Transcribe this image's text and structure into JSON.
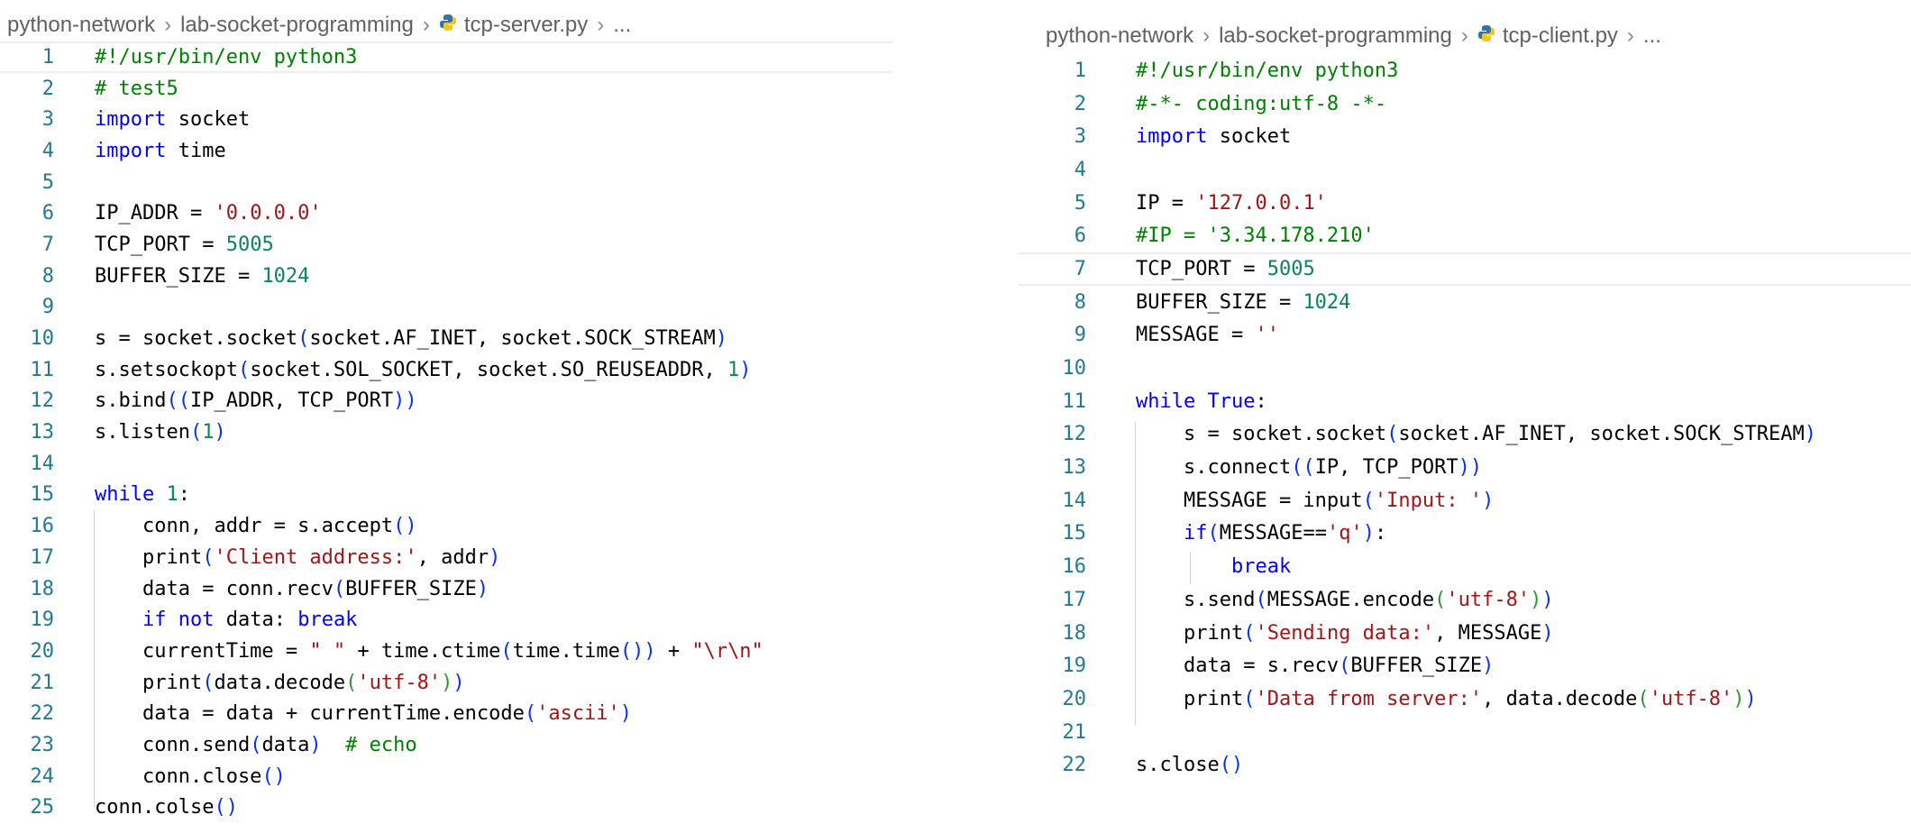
{
  "left_pane": {
    "breadcrumb": {
      "folder": "python-network",
      "subfolder": "lab-socket-programming",
      "file": "tcp-server.py",
      "more": "..."
    },
    "lines": [
      {
        "n": "1",
        "tokens": [
          {
            "t": "#!/usr/bin/env python3",
            "c": "#008000"
          }
        ]
      },
      {
        "n": "2",
        "tokens": [
          {
            "t": "# test5",
            "c": "#008000"
          }
        ]
      },
      {
        "n": "3",
        "tokens": [
          {
            "t": "import",
            "c": "#0000ff"
          },
          {
            "t": " socket",
            "c": "#000000"
          }
        ]
      },
      {
        "n": "4",
        "tokens": [
          {
            "t": "import",
            "c": "#0000ff"
          },
          {
            "t": " time",
            "c": "#000000"
          }
        ]
      },
      {
        "n": "5",
        "tokens": []
      },
      {
        "n": "6",
        "tokens": [
          {
            "t": "IP_ADDR = ",
            "c": "#000000"
          },
          {
            "t": "'0.0.0.0'",
            "c": "#a31515"
          }
        ]
      },
      {
        "n": "7",
        "tokens": [
          {
            "t": "TCP_PORT = ",
            "c": "#000000"
          },
          {
            "t": "5005",
            "c": "#098658"
          }
        ]
      },
      {
        "n": "8",
        "tokens": [
          {
            "t": "BUFFER_SIZE = ",
            "c": "#000000"
          },
          {
            "t": "1024",
            "c": "#098658"
          }
        ]
      },
      {
        "n": "9",
        "tokens": []
      },
      {
        "n": "10",
        "tokens": [
          {
            "t": "s = socket.socket",
            "c": "#000000"
          },
          {
            "t": "(",
            "c": "#0431fa"
          },
          {
            "t": "socket.AF_INET, socket.SOCK_STREAM",
            "c": "#000000"
          },
          {
            "t": ")",
            "c": "#0431fa"
          }
        ]
      },
      {
        "n": "11",
        "tokens": [
          {
            "t": "s.setsockopt",
            "c": "#000000"
          },
          {
            "t": "(",
            "c": "#0431fa"
          },
          {
            "t": "socket.SOL_SOCKET, socket.SO_REUSEADDR, ",
            "c": "#000000"
          },
          {
            "t": "1",
            "c": "#098658"
          },
          {
            "t": ")",
            "c": "#0431fa"
          }
        ]
      },
      {
        "n": "12",
        "tokens": [
          {
            "t": "s.bind",
            "c": "#000000"
          },
          {
            "t": "((",
            "c": "#0431fa"
          },
          {
            "t": "IP_ADDR, TCP_PORT",
            "c": "#000000"
          },
          {
            "t": "))",
            "c": "#0431fa"
          }
        ]
      },
      {
        "n": "13",
        "tokens": [
          {
            "t": "s.listen",
            "c": "#000000"
          },
          {
            "t": "(",
            "c": "#0431fa"
          },
          {
            "t": "1",
            "c": "#098658"
          },
          {
            "t": ")",
            "c": "#0431fa"
          }
        ]
      },
      {
        "n": "14",
        "tokens": []
      },
      {
        "n": "15",
        "tokens": [
          {
            "t": "while",
            "c": "#0000ff"
          },
          {
            "t": " ",
            "c": "#000000"
          },
          {
            "t": "1",
            "c": "#098658"
          },
          {
            "t": ":",
            "c": "#000000"
          }
        ]
      },
      {
        "n": "16",
        "tokens": [
          {
            "t": "    conn, addr = s.accept",
            "c": "#000000"
          },
          {
            "t": "()",
            "c": "#0431fa"
          }
        ]
      },
      {
        "n": "17",
        "tokens": [
          {
            "t": "    print",
            "c": "#000000"
          },
          {
            "t": "(",
            "c": "#0431fa"
          },
          {
            "t": "'Client address:'",
            "c": "#a31515"
          },
          {
            "t": ", addr",
            "c": "#000000"
          },
          {
            "t": ")",
            "c": "#0431fa"
          }
        ]
      },
      {
        "n": "18",
        "tokens": [
          {
            "t": "    data = conn.recv",
            "c": "#000000"
          },
          {
            "t": "(",
            "c": "#0431fa"
          },
          {
            "t": "BUFFER_SIZE",
            "c": "#000000"
          },
          {
            "t": ")",
            "c": "#0431fa"
          }
        ]
      },
      {
        "n": "19",
        "tokens": [
          {
            "t": "    ",
            "c": "#000000"
          },
          {
            "t": "if",
            "c": "#0000ff"
          },
          {
            "t": " ",
            "c": "#000000"
          },
          {
            "t": "not",
            "c": "#0000ff"
          },
          {
            "t": " data: ",
            "c": "#000000"
          },
          {
            "t": "break",
            "c": "#0000ff"
          }
        ]
      },
      {
        "n": "20",
        "tokens": [
          {
            "t": "    currentTime = ",
            "c": "#000000"
          },
          {
            "t": "\" \"",
            "c": "#a31515"
          },
          {
            "t": " + time.ctime",
            "c": "#000000"
          },
          {
            "t": "(",
            "c": "#0431fa"
          },
          {
            "t": "time.time",
            "c": "#000000"
          },
          {
            "t": "())",
            "c": "#0431fa"
          },
          {
            "t": " + ",
            "c": "#000000"
          },
          {
            "t": "\"\\r\\n\"",
            "c": "#a31515"
          }
        ]
      },
      {
        "n": "21",
        "tokens": [
          {
            "t": "    print",
            "c": "#000000"
          },
          {
            "t": "(",
            "c": "#0431fa"
          },
          {
            "t": "data.decode",
            "c": "#000000"
          },
          {
            "t": "(",
            "c": "#319331"
          },
          {
            "t": "'utf-8'",
            "c": "#a31515"
          },
          {
            "t": ")",
            "c": "#319331"
          },
          {
            "t": ")",
            "c": "#0431fa"
          }
        ]
      },
      {
        "n": "22",
        "tokens": [
          {
            "t": "    data = data + currentTime.encode",
            "c": "#000000"
          },
          {
            "t": "(",
            "c": "#0431fa"
          },
          {
            "t": "'ascii'",
            "c": "#a31515"
          },
          {
            "t": ")",
            "c": "#0431fa"
          }
        ]
      },
      {
        "n": "23",
        "tokens": [
          {
            "t": "    conn.send",
            "c": "#000000"
          },
          {
            "t": "(",
            "c": "#0431fa"
          },
          {
            "t": "data",
            "c": "#000000"
          },
          {
            "t": ")",
            "c": "#0431fa"
          },
          {
            "t": "  ",
            "c": "#000000"
          },
          {
            "t": "# echo",
            "c": "#008000"
          }
        ]
      },
      {
        "n": "24",
        "tokens": [
          {
            "t": "    conn.close",
            "c": "#000000"
          },
          {
            "t": "()",
            "c": "#0431fa"
          }
        ]
      },
      {
        "n": "25",
        "tokens": [
          {
            "t": "conn.colse",
            "c": "#000000"
          },
          {
            "t": "()",
            "c": "#0431fa"
          }
        ]
      }
    ]
  },
  "right_pane": {
    "breadcrumb": {
      "folder": "python-network",
      "subfolder": "lab-socket-programming",
      "file": "tcp-client.py",
      "more": "..."
    },
    "lines": [
      {
        "n": "1",
        "tokens": [
          {
            "t": "#!/usr/bin/env python3",
            "c": "#008000"
          }
        ]
      },
      {
        "n": "2",
        "tokens": [
          {
            "t": "#-*- coding:utf-8 -*-",
            "c": "#008000"
          }
        ]
      },
      {
        "n": "3",
        "tokens": [
          {
            "t": "import",
            "c": "#0000ff"
          },
          {
            "t": " socket",
            "c": "#000000"
          }
        ]
      },
      {
        "n": "4",
        "tokens": []
      },
      {
        "n": "5",
        "tokens": [
          {
            "t": "IP = ",
            "c": "#000000"
          },
          {
            "t": "'127.0.0.1'",
            "c": "#a31515"
          }
        ]
      },
      {
        "n": "6",
        "tokens": [
          {
            "t": "#IP = '3.34.178.210'",
            "c": "#008000"
          }
        ]
      },
      {
        "n": "7",
        "tokens": [
          {
            "t": "TCP_PORT = ",
            "c": "#000000"
          },
          {
            "t": "5005",
            "c": "#098658"
          }
        ]
      },
      {
        "n": "8",
        "tokens": [
          {
            "t": "BUFFER_SIZE = ",
            "c": "#000000"
          },
          {
            "t": "1024",
            "c": "#098658"
          }
        ]
      },
      {
        "n": "9",
        "tokens": [
          {
            "t": "MESSAGE = ",
            "c": "#000000"
          },
          {
            "t": "''",
            "c": "#a31515"
          }
        ]
      },
      {
        "n": "10",
        "tokens": []
      },
      {
        "n": "11",
        "tokens": [
          {
            "t": "while",
            "c": "#0000ff"
          },
          {
            "t": " ",
            "c": "#000000"
          },
          {
            "t": "True",
            "c": "#0000ff"
          },
          {
            "t": ":",
            "c": "#000000"
          }
        ]
      },
      {
        "n": "12",
        "tokens": [
          {
            "t": "    s = socket.socket",
            "c": "#000000"
          },
          {
            "t": "(",
            "c": "#0431fa"
          },
          {
            "t": "socket.AF_INET, socket.SOCK_STREAM",
            "c": "#000000"
          },
          {
            "t": ")",
            "c": "#0431fa"
          }
        ]
      },
      {
        "n": "13",
        "tokens": [
          {
            "t": "    s.connect",
            "c": "#000000"
          },
          {
            "t": "((",
            "c": "#0431fa"
          },
          {
            "t": "IP, TCP_PORT",
            "c": "#000000"
          },
          {
            "t": "))",
            "c": "#0431fa"
          }
        ]
      },
      {
        "n": "14",
        "tokens": [
          {
            "t": "    MESSAGE = input",
            "c": "#000000"
          },
          {
            "t": "(",
            "c": "#0431fa"
          },
          {
            "t": "'Input: '",
            "c": "#a31515"
          },
          {
            "t": ")",
            "c": "#0431fa"
          }
        ]
      },
      {
        "n": "15",
        "tokens": [
          {
            "t": "    ",
            "c": "#000000"
          },
          {
            "t": "if",
            "c": "#0000ff"
          },
          {
            "t": "(",
            "c": "#0431fa"
          },
          {
            "t": "MESSAGE==",
            "c": "#000000"
          },
          {
            "t": "'q'",
            "c": "#a31515"
          },
          {
            "t": ")",
            "c": "#0431fa"
          },
          {
            "t": ":",
            "c": "#000000"
          }
        ]
      },
      {
        "n": "16",
        "tokens": [
          {
            "t": "        ",
            "c": "#000000"
          },
          {
            "t": "break",
            "c": "#0000ff"
          }
        ]
      },
      {
        "n": "17",
        "tokens": [
          {
            "t": "    s.send",
            "c": "#000000"
          },
          {
            "t": "(",
            "c": "#0431fa"
          },
          {
            "t": "MESSAGE.encode",
            "c": "#000000"
          },
          {
            "t": "(",
            "c": "#319331"
          },
          {
            "t": "'utf-8'",
            "c": "#a31515"
          },
          {
            "t": ")",
            "c": "#319331"
          },
          {
            "t": ")",
            "c": "#0431fa"
          }
        ]
      },
      {
        "n": "18",
        "tokens": [
          {
            "t": "    print",
            "c": "#000000"
          },
          {
            "t": "(",
            "c": "#0431fa"
          },
          {
            "t": "'Sending data:'",
            "c": "#a31515"
          },
          {
            "t": ", MESSAGE",
            "c": "#000000"
          },
          {
            "t": ")",
            "c": "#0431fa"
          }
        ]
      },
      {
        "n": "19",
        "tokens": [
          {
            "t": "    data = s.recv",
            "c": "#000000"
          },
          {
            "t": "(",
            "c": "#0431fa"
          },
          {
            "t": "BUFFER_SIZE",
            "c": "#000000"
          },
          {
            "t": ")",
            "c": "#0431fa"
          }
        ]
      },
      {
        "n": "20",
        "tokens": [
          {
            "t": "    print",
            "c": "#000000"
          },
          {
            "t": "(",
            "c": "#0431fa"
          },
          {
            "t": "'Data from server:'",
            "c": "#a31515"
          },
          {
            "t": ", data.decode",
            "c": "#000000"
          },
          {
            "t": "(",
            "c": "#319331"
          },
          {
            "t": "'utf-8'",
            "c": "#a31515"
          },
          {
            "t": ")",
            "c": "#319331"
          },
          {
            "t": ")",
            "c": "#0431fa"
          }
        ]
      },
      {
        "n": "21",
        "tokens": []
      },
      {
        "n": "22",
        "tokens": [
          {
            "t": "s.close",
            "c": "#000000"
          },
          {
            "t": "()",
            "c": "#0431fa"
          }
        ]
      }
    ]
  },
  "colors": {
    "line_number": "#237893",
    "comment": "#008000",
    "keyword": "#0000ff",
    "string": "#a31515",
    "number": "#098658",
    "bracket_level1": "#0431fa",
    "bracket_level2": "#319331",
    "breadcrumb_text": "#616161",
    "python_icon_blue": "#3572a5",
    "python_icon_yellow": "#f5c518"
  },
  "icons": {
    "python_file": "python-file-icon",
    "chevron": "chevron-right-icon"
  }
}
